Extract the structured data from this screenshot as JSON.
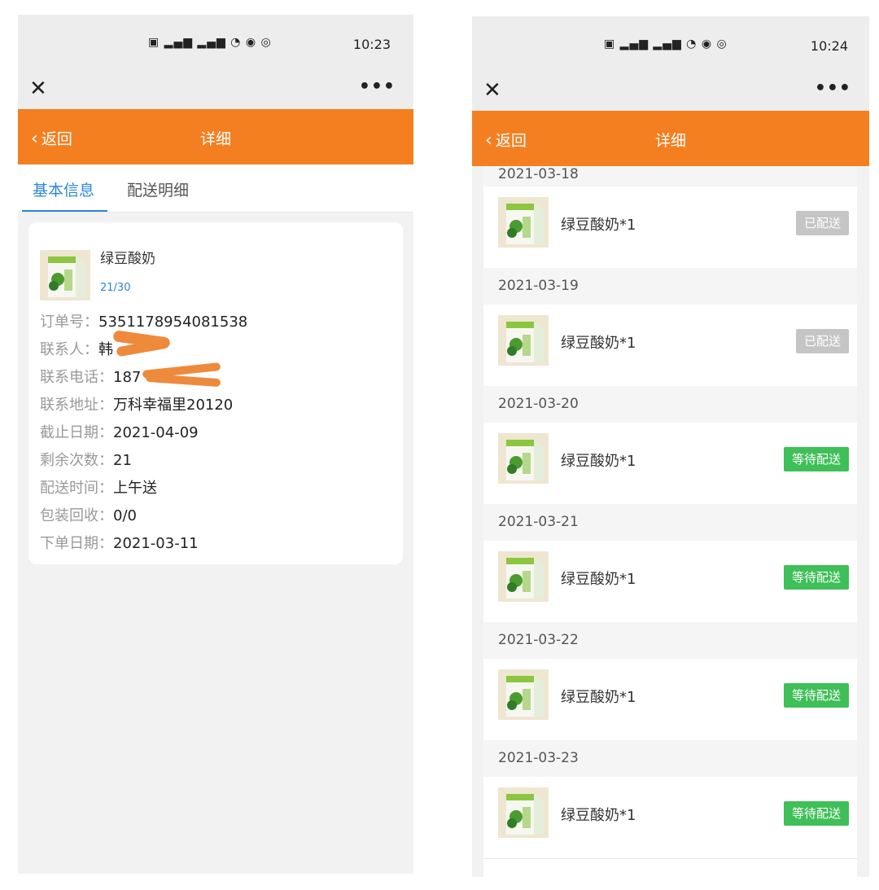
{
  "colors": {
    "header": "#f47f21",
    "tab_active": "#2d86d8",
    "badge_done": "#c5c5c5",
    "badge_wait": "#3fbf58"
  },
  "left": {
    "status": {
      "icons": "HD 5G 4G wifi",
      "time": "10:23"
    },
    "nav": {
      "back_label": "返回",
      "title": "详细"
    },
    "tabs": [
      {
        "label": "基本信息",
        "active": true
      },
      {
        "label": "配送明细",
        "active": false
      }
    ],
    "product": {
      "name": "绿豆酸奶",
      "count": "21/30"
    },
    "info": [
      {
        "label": "订单号：",
        "value": "5351178954081538"
      },
      {
        "label": "联系人：",
        "value": "韩"
      },
      {
        "label": "联系电话：",
        "value": "187"
      },
      {
        "label": "联系地址：",
        "value": "万科幸福里20120"
      },
      {
        "label": "截止日期：",
        "value": "2021-04-09"
      },
      {
        "label": "剩余次数：",
        "value": "21"
      },
      {
        "label": "配送时间：",
        "value": "上午送"
      },
      {
        "label": "包装回收：",
        "value": "0/0"
      },
      {
        "label": "下单日期：",
        "value": "2021-03-11"
      }
    ]
  },
  "right": {
    "status": {
      "icons": "HD 5G 4G wifi",
      "time": "10:24"
    },
    "nav": {
      "back_label": "返回",
      "title": "详细"
    },
    "deliveries": [
      {
        "date": "2021-03-18",
        "item": "绿豆酸奶*1",
        "status": "已配送",
        "state": "done"
      },
      {
        "date": "2021-03-19",
        "item": "绿豆酸奶*1",
        "status": "已配送",
        "state": "done"
      },
      {
        "date": "2021-03-20",
        "item": "绿豆酸奶*1",
        "status": "等待配送",
        "state": "wait"
      },
      {
        "date": "2021-03-21",
        "item": "绿豆酸奶*1",
        "status": "等待配送",
        "state": "wait"
      },
      {
        "date": "2021-03-22",
        "item": "绿豆酸奶*1",
        "status": "等待配送",
        "state": "wait"
      },
      {
        "date": "2021-03-23",
        "item": "绿豆酸奶*1",
        "status": "等待配送",
        "state": "wait"
      }
    ]
  }
}
